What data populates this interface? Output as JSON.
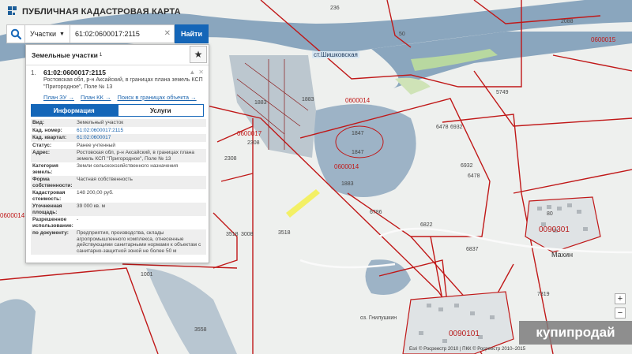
{
  "app": {
    "title": "ПУБЛИЧНАЯ КАДАСТРОВАЯ КАРТА"
  },
  "search": {
    "type": "Участки",
    "query": "61:02:0600017:2115",
    "button": "Найти"
  },
  "panel": {
    "title": "Земельные участки",
    "count": "1",
    "result": {
      "index": "1.",
      "cad_number": "61:02:0600017:2115",
      "address": "Ростовская обл, р-н Аксайский, в границах плана земель КСП \"Пригородное\", Поле № 13",
      "links": [
        "План ЗУ →",
        "План КК →",
        "Поиск в границах объекта →"
      ]
    },
    "tabs": [
      "Информация",
      "Услуги"
    ],
    "info": [
      {
        "k": "Вид:",
        "v": "Земельный участок"
      },
      {
        "k": "Кад. номер:",
        "v": "61:02:0600017:2115",
        "link": true
      },
      {
        "k": "Кад. квартал:",
        "v": "61:02:0600017",
        "link": true
      },
      {
        "k": "Статус:",
        "v": "Ранее учтенный"
      },
      {
        "k": "Адрес:",
        "v": "Ростовская обл, р-н Аксайский, в границах плана земель КСП \"Пригородное\", Поле № 13"
      },
      {
        "k": "Категория земель:",
        "v": "Земли сельскохозяйственного назначения"
      },
      {
        "k": "Форма собственности:",
        "v": "Частная собственность"
      },
      {
        "k": "Кадастровая стоимость:",
        "v": "148 200,00 руб."
      },
      {
        "k": "Уточненная площадь:",
        "v": "39 000 кв. м"
      },
      {
        "k": "Разрешенное использование:",
        "v": "-"
      },
      {
        "k": "по документу:",
        "v": "Предприятия, производства, склады агропромышленного комплекса, отнесенные действующими санитарными нормами к объектам с санитарно-защитной зоной не более 50 м"
      }
    ]
  },
  "map": {
    "labels": [
      {
        "t": "236"
      },
      {
        "t": "50"
      },
      {
        "t": "0600015"
      },
      {
        "t": "2088"
      },
      {
        "t": "ст.Шишковская"
      },
      {
        "t": "5749"
      },
      {
        "t": "0600014"
      },
      {
        "t": "6478"
      },
      {
        "t": "6932"
      },
      {
        "t": "6932"
      },
      {
        "t": "6478"
      },
      {
        "t": "1883"
      },
      {
        "t": "1883"
      },
      {
        "t": "1847"
      },
      {
        "t": "1847"
      },
      {
        "t": "0600014"
      },
      {
        "t": "0600017"
      },
      {
        "t": "2308"
      },
      {
        "t": "2308"
      },
      {
        "t": "1883"
      },
      {
        "t": "6786"
      },
      {
        "t": "6822"
      },
      {
        "t": "6837"
      },
      {
        "t": "3518"
      },
      {
        "t": "3008"
      },
      {
        "t": "3518"
      },
      {
        "t": "1001"
      },
      {
        "t": "3558"
      },
      {
        "t": "0090301"
      },
      {
        "t": "Махин"
      },
      {
        "t": "80"
      },
      {
        "t": "7319"
      },
      {
        "t": "0090101"
      },
      {
        "t": "оз. Гнилушкин"
      },
      {
        "t": "0600014"
      }
    ]
  },
  "zoom": {
    "in": "+",
    "out": "−"
  },
  "footer": {
    "attribution": "Esri © Росреестр 2010 | ПКК © Росреестр 2010–2015"
  },
  "watermark": "купипродай",
  "colors": {
    "accent": "#1466b8",
    "parcel": "#c01818",
    "water": "#8aa6be"
  }
}
